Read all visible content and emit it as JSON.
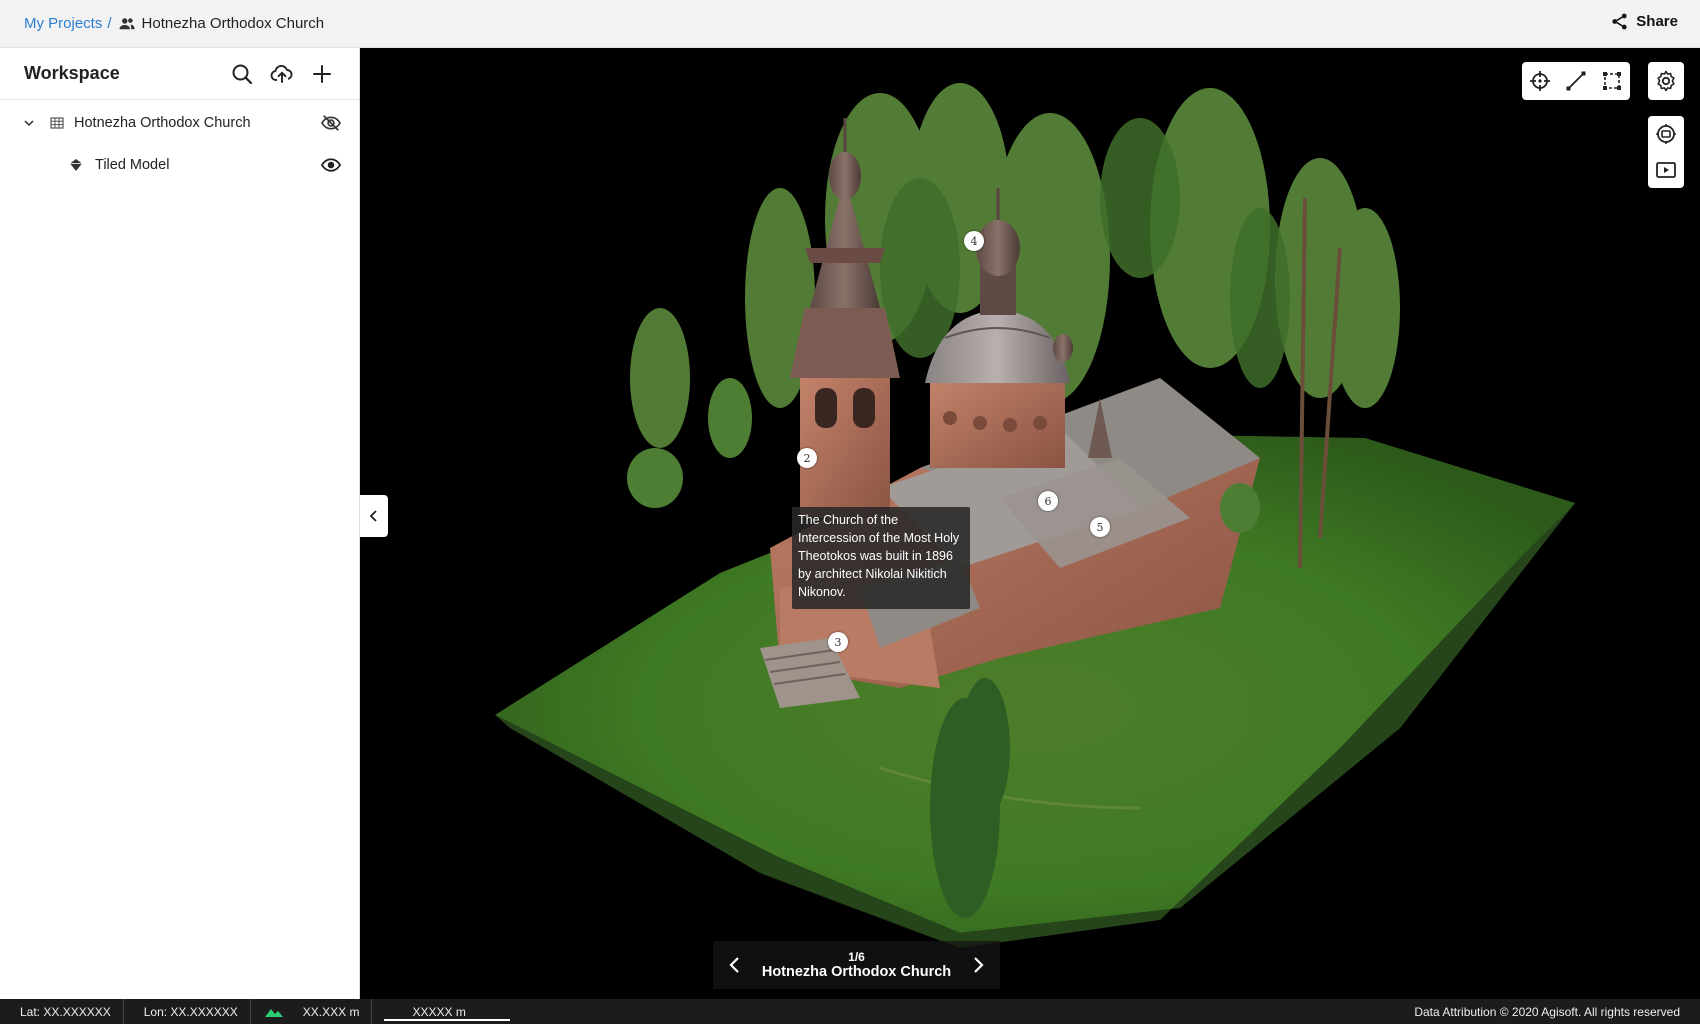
{
  "breadcrumb": {
    "root": "My Projects",
    "separator": "/",
    "current": "Hotnezha Orthodox Church"
  },
  "header": {
    "share_label": "Share"
  },
  "sidebar": {
    "title": "Workspace",
    "tree": [
      {
        "label": "Hotnezha Orthodox Church",
        "visible": false
      },
      {
        "label": "Tiled Model",
        "visible": true
      }
    ]
  },
  "viewport": {
    "tooltip": "The Church of the Intercession of the Most Holy Theotokos was built in 1896 by architect Nikolai Nikitich Nikonov.",
    "pins": [
      "2",
      "3",
      "4",
      "5",
      "6"
    ],
    "tour": {
      "count": "1/6",
      "title": "Hotnezha Orthodox Church"
    }
  },
  "statusbar": {
    "lat": "Lat: XX.XXXXXX",
    "lon": "Lon: XX.XXXXXX",
    "altitude": "XX.XXX m",
    "scale": "XXXXX m",
    "attribution": "Data Attribution © 2020 Agisoft. All rights reserved"
  },
  "colors": {
    "link": "#2b7fd0",
    "altitude_icon": "#2ecc71"
  }
}
